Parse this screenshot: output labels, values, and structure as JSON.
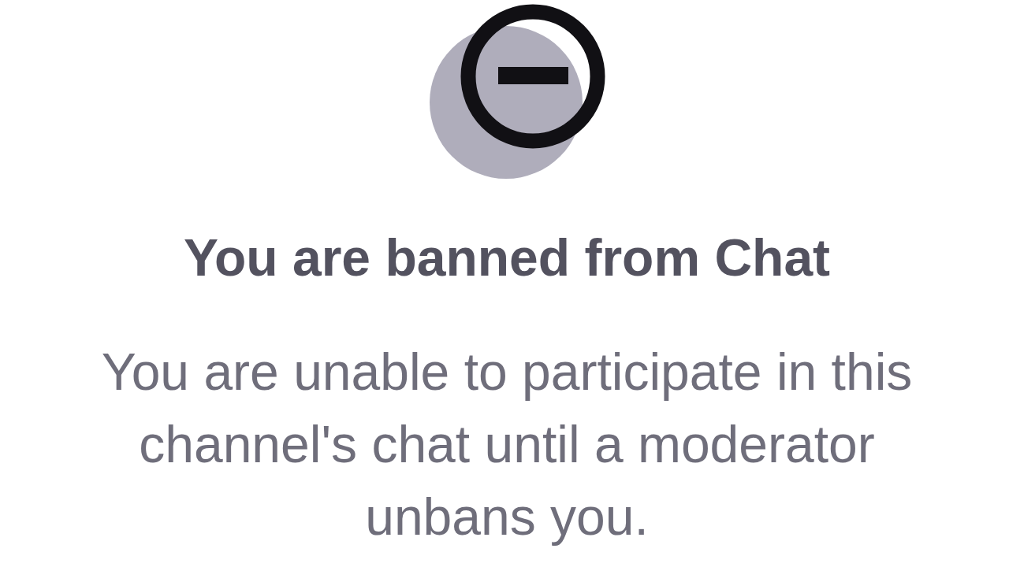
{
  "notice": {
    "title": "You are banned from Chat",
    "message": "You are unable to participate in this channel's chat until a moderator unbans you."
  }
}
